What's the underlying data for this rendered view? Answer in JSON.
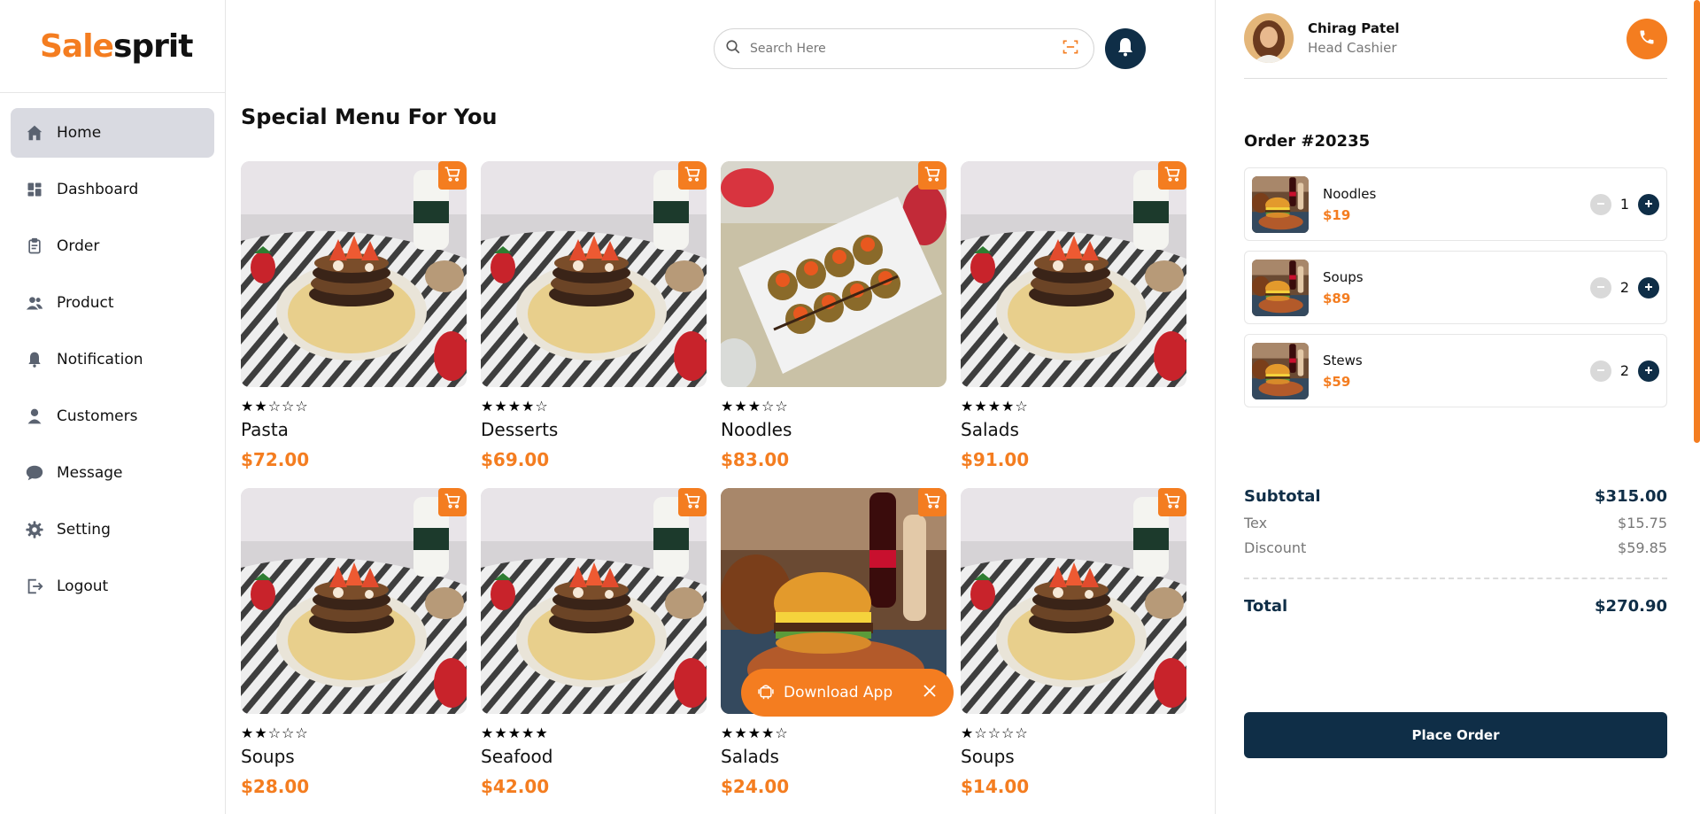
{
  "brand": {
    "part1": "Sale",
    "part2": "sprit",
    "accent": "#f47d20"
  },
  "sidebar": {
    "items": [
      {
        "label": "Home",
        "icon": "home-icon",
        "active": true
      },
      {
        "label": "Dashboard",
        "icon": "dashboard-icon"
      },
      {
        "label": "Order",
        "icon": "clipboard-icon"
      },
      {
        "label": "Product",
        "icon": "users-icon"
      },
      {
        "label": "Notification",
        "icon": "bell-icon"
      },
      {
        "label": "Customers",
        "icon": "user-icon"
      },
      {
        "label": "Message",
        "icon": "chat-icon"
      },
      {
        "label": "Setting",
        "icon": "gear-icon"
      },
      {
        "label": "Logout",
        "icon": "logout-icon"
      }
    ]
  },
  "search": {
    "placeholder": "Search Here"
  },
  "main": {
    "title": "Special Menu For You"
  },
  "products": [
    {
      "name": "Pasta",
      "price": "$72.00",
      "rating": "★★☆☆☆",
      "image": "pancake"
    },
    {
      "name": "Desserts",
      "price": "$69.00",
      "rating": "★★★★☆",
      "image": "pancake"
    },
    {
      "name": "Noodles",
      "price": "$83.00",
      "rating": "★★★☆☆",
      "image": "sushi"
    },
    {
      "name": "Salads",
      "price": "$91.00",
      "rating": "★★★★☆",
      "image": "pancake"
    },
    {
      "name": "Soups",
      "price": "$28.00",
      "rating": "★★☆☆☆",
      "image": "pancake"
    },
    {
      "name": "Seafood",
      "price": "$42.00",
      "rating": "★★★★★",
      "image": "pancake"
    },
    {
      "name": "Salads",
      "price": "$24.00",
      "rating": "★★★★☆",
      "image": "burger"
    },
    {
      "name": "Soups",
      "price": "$14.00",
      "rating": "★☆☆☆☆",
      "image": "pancake"
    }
  ],
  "download": {
    "label": "Download App"
  },
  "profile": {
    "name": "Chirag Patel",
    "role": "Head Cashier"
  },
  "order": {
    "title": "Order #20235",
    "items": [
      {
        "name": "Noodles",
        "price": "$19",
        "qty": "1"
      },
      {
        "name": "Soups",
        "price": "$89",
        "qty": "2"
      },
      {
        "name": "Stews",
        "price": "$59",
        "qty": "2"
      }
    ]
  },
  "summary": {
    "subtotal_label": "Subtotal",
    "subtotal": "$315.00",
    "tax_label": "Tex",
    "tax": "$15.75",
    "discount_label": "Discount",
    "discount": "$59.85",
    "total_label": "Total",
    "total": "$270.90"
  },
  "place_order": "Place Order",
  "colors": {
    "navy": "#0f2e47",
    "orange": "#f47d20"
  }
}
